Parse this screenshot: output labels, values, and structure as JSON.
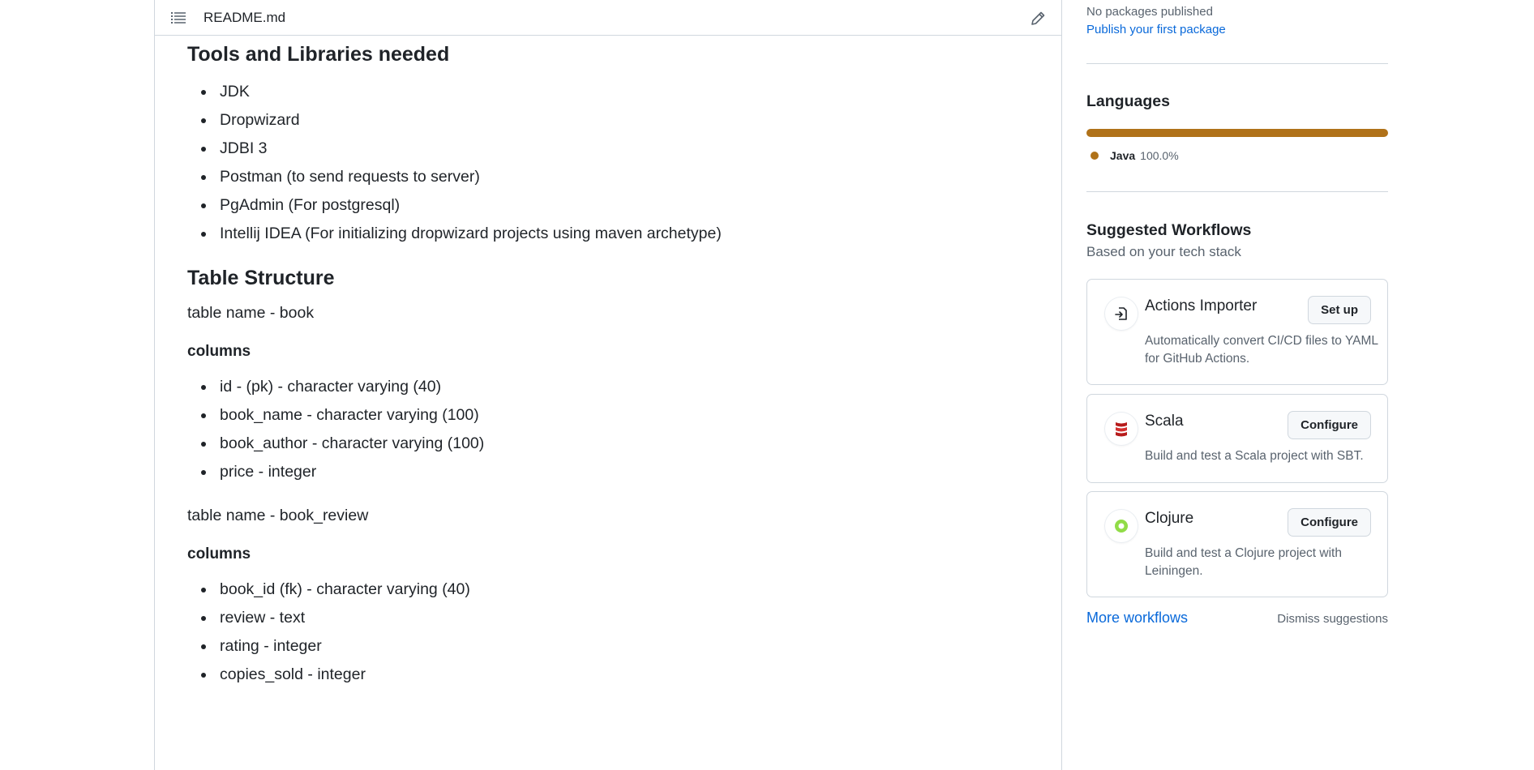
{
  "readme": {
    "filename": "README.md",
    "tools_heading": "Tools and Libraries needed",
    "tools": [
      "JDK",
      "Dropwizard",
      "JDBI 3",
      "Postman (to send requests to server)",
      "PgAdmin (For postgresql)",
      "Intellij IDEA (For initializing dropwizard projects using maven archetype)"
    ],
    "table_heading": "Table Structure",
    "table1_name": "table name - book",
    "columns_label": "columns",
    "table1_columns": [
      "id - (pk) - character varying (40)",
      "book_name - character varying (100)",
      "book_author - character varying (100)",
      "price - integer"
    ],
    "table2_name": "table name - book_review",
    "table2_columns": [
      "book_id (fk) - character varying (40)",
      "review - text",
      "rating - integer",
      "copies_sold - integer"
    ]
  },
  "sidebar": {
    "packages_status": "No packages published",
    "publish_link": "Publish your first package",
    "languages_heading": "Languages",
    "languages": [
      {
        "name": "Java",
        "percent": "100.0%",
        "color": "#b07219"
      }
    ],
    "workflows_heading": "Suggested Workflows",
    "workflows_subheading": "Based on your tech stack",
    "workflows": [
      {
        "name": "Actions Importer",
        "button": "Set up",
        "description": "Automatically convert CI/CD files to YAML for GitHub Actions."
      },
      {
        "name": "Scala",
        "button": "Configure",
        "description": "Build and test a Scala project with SBT."
      },
      {
        "name": "Clojure",
        "button": "Configure",
        "description": "Build and test a Clojure project with Leiningen."
      }
    ],
    "more_workflows": "More workflows",
    "dismiss": "Dismiss suggestions"
  }
}
